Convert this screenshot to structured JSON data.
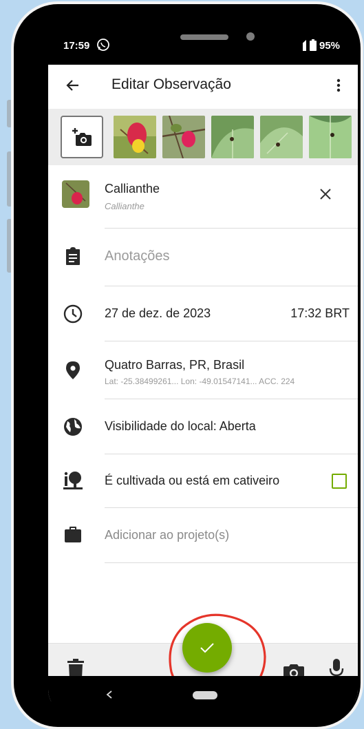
{
  "status_bar": {
    "time": "17:59",
    "battery": "95%"
  },
  "toolbar": {
    "title": "Editar Observação",
    "back_icon": "arrow-left-icon",
    "menu_icon": "more-vert-icon"
  },
  "photos": {
    "add_icon": "add-photo-icon",
    "count": 5
  },
  "species": {
    "common_name": "Callianthe",
    "scientific_name": "Callianthe",
    "remove_icon": "close-icon"
  },
  "notes": {
    "placeholder": "Anotações",
    "icon": "clipboard-icon"
  },
  "datetime": {
    "date": "27 de dez. de 2023",
    "time": "17:32 BRT",
    "icon": "clock-icon"
  },
  "location": {
    "place": "Quatro Barras, PR, Brasil",
    "coords": "Lat: -25.38499261... Lon: -49.01547141... ACC. 224",
    "icon": "map-pin-icon"
  },
  "visibility": {
    "label": "Visibilidade do local: Aberta",
    "icon": "globe-icon"
  },
  "captive": {
    "label": "É cultivada ou está em cativeiro",
    "checked": false,
    "icon": "captive-plant-icon"
  },
  "projects": {
    "placeholder": "Adicionar ao projeto(s)",
    "icon": "briefcase-icon"
  },
  "bottom_bar": {
    "delete_icon": "trash-icon",
    "camera_icon": "camera-icon",
    "mic_icon": "microphone-icon"
  },
  "fab": {
    "icon": "check-icon"
  },
  "colors": {
    "accent": "#74ac00",
    "annotation": "#e5352a",
    "background": "#b9d8f1"
  }
}
